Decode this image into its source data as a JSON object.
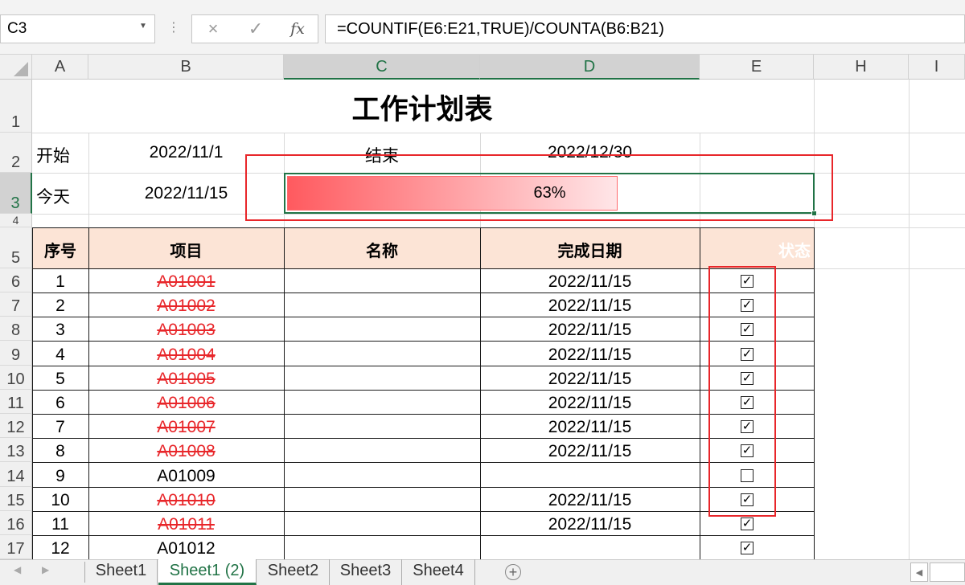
{
  "formula_bar": {
    "name_box": "C3",
    "cancel_icon": "×",
    "enter_icon": "✓",
    "fx_label": "fx",
    "formula": "=COUNTIF(E6:E21,TRUE)/COUNTA(B6:B21)"
  },
  "columns": [
    "A",
    "B",
    "C",
    "D",
    "E",
    "H",
    "I"
  ],
  "rows": [
    "1",
    "2",
    "3",
    "4",
    "5",
    "6",
    "7",
    "8",
    "9",
    "10",
    "11",
    "12",
    "13",
    "14",
    "15",
    "16",
    "17"
  ],
  "sheet": {
    "title": "工作计划表",
    "start_label": "开始",
    "start_date": "2022/11/1",
    "end_label": "结束",
    "end_date": "2022/12/30",
    "today_label": "今天",
    "today_date": "2022/11/15",
    "progress_text": "63%",
    "progress_fraction": 0.63,
    "progress_color": "#ff5a5f",
    "headers": {
      "no": "序号",
      "item": "项目",
      "name": "名称",
      "date": "完成日期",
      "status": "状态"
    },
    "tasks": [
      {
        "no": "1",
        "item": "A01001",
        "date": "2022/11/15",
        "checked": true
      },
      {
        "no": "2",
        "item": "A01002",
        "date": "2022/11/15",
        "checked": true
      },
      {
        "no": "3",
        "item": "A01003",
        "date": "2022/11/15",
        "checked": true
      },
      {
        "no": "4",
        "item": "A01004",
        "date": "2022/11/15",
        "checked": true
      },
      {
        "no": "5",
        "item": "A01005",
        "date": "2022/11/15",
        "checked": true
      },
      {
        "no": "6",
        "item": "A01006",
        "date": "2022/11/15",
        "checked": true
      },
      {
        "no": "7",
        "item": "A01007",
        "date": "2022/11/15",
        "checked": true
      },
      {
        "no": "8",
        "item": "A01008",
        "date": "2022/11/15",
        "checked": true
      },
      {
        "no": "9",
        "item": "A01009",
        "date": "",
        "checked": false
      },
      {
        "no": "10",
        "item": "A01010",
        "date": "2022/11/15",
        "checked": true
      },
      {
        "no": "11",
        "item": "A01011",
        "date": "2022/11/15",
        "checked": true
      },
      {
        "no": "12",
        "item": "A01012",
        "date": "",
        "checked": true
      }
    ]
  },
  "tabs": {
    "prev_icon": "◀",
    "next_icon": "▶",
    "items": [
      "Sheet1",
      "Sheet1 (2)",
      "Sheet2",
      "Sheet3",
      "Sheet4"
    ],
    "active": "Sheet1 (2)",
    "add_icon": "+"
  },
  "colors": {
    "accent": "#217346",
    "header_fill": "#fce4d6",
    "annotation": "#e8262a"
  }
}
